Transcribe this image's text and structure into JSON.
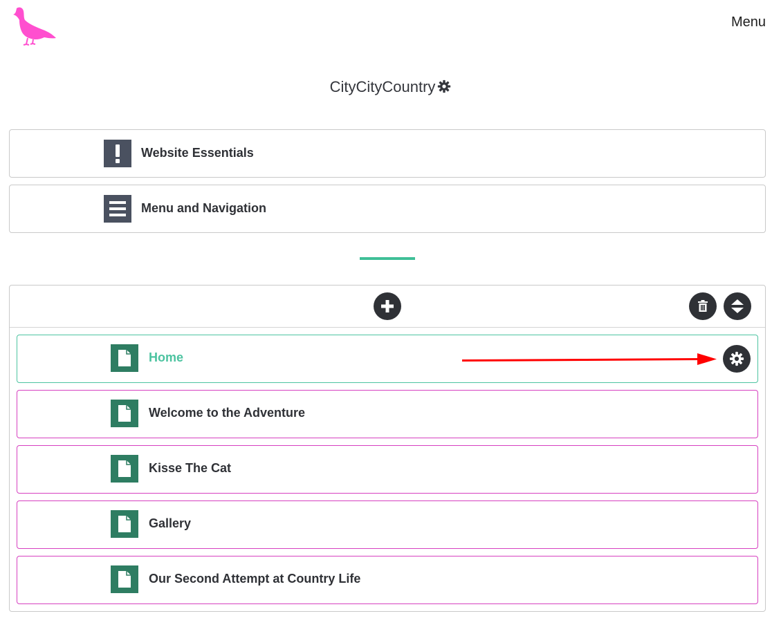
{
  "header": {
    "menu_label": "Menu",
    "site_title": "CityCityCountry"
  },
  "sections": [
    {
      "label": "Website Essentials",
      "icon": "exclamation-icon"
    },
    {
      "label": "Menu and Navigation",
      "icon": "menu-lines-icon"
    }
  ],
  "pages": {
    "items": [
      {
        "label": "Home",
        "active": true
      },
      {
        "label": "Welcome to the Adventure",
        "active": false
      },
      {
        "label": "Kisse The Cat",
        "active": false
      },
      {
        "label": "Gallery",
        "active": false
      },
      {
        "label": "Our Second Attempt at Country Life",
        "active": false
      }
    ]
  },
  "colors": {
    "logo": "#ff4fcf",
    "accent": "#3fbf97",
    "page_icon": "#2e7d62",
    "row_border": "#d63fc0",
    "section_icon": "#4a5160",
    "annotation_arrow": "#ff0000"
  }
}
